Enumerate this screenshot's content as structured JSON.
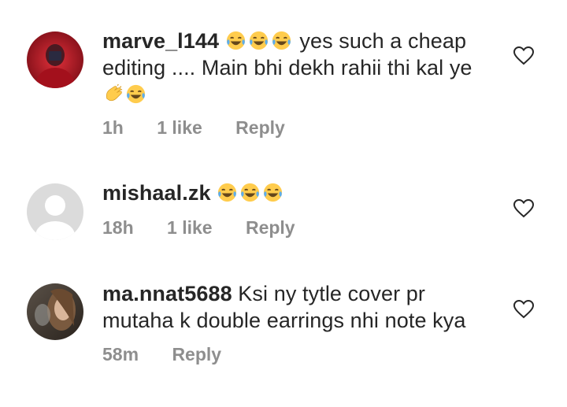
{
  "comments": [
    {
      "username": "marve_l144",
      "text_line1": "yes such a cheap",
      "text_line2": "editing .... Main bhi dekh rahii thi kal ye",
      "emojis_after_name": [
        "laughing-tears",
        "laughing-tears",
        "laughing-tears"
      ],
      "emojis_line3": [
        "clapping-hands",
        "laughing-tears"
      ],
      "time": "1h",
      "likes": "1 like",
      "reply_label": "Reply",
      "avatar_colors": [
        "#c2121f",
        "#6c0b16"
      ]
    },
    {
      "username": "mishaal.zk",
      "emojis_after_name": [
        "laughing-tears",
        "laughing-tears",
        "laughing-tears"
      ],
      "time": "18h",
      "likes": "1 like",
      "reply_label": "Reply",
      "avatar_colors": [
        "#dbdbdb",
        "#ffffff"
      ]
    },
    {
      "username": "ma.nnat5688",
      "text_line1": "Ksi ny tytle cover pr",
      "text_line2": "mutaha k double earrings nhi note kya",
      "time": "58m",
      "reply_label": "Reply",
      "avatar_colors": [
        "#8a7b6c",
        "#3e342b"
      ]
    }
  ],
  "icons": {
    "like": "heart-outline-icon"
  },
  "colors": {
    "text": "#262626",
    "meta": "#8e8e8e"
  }
}
